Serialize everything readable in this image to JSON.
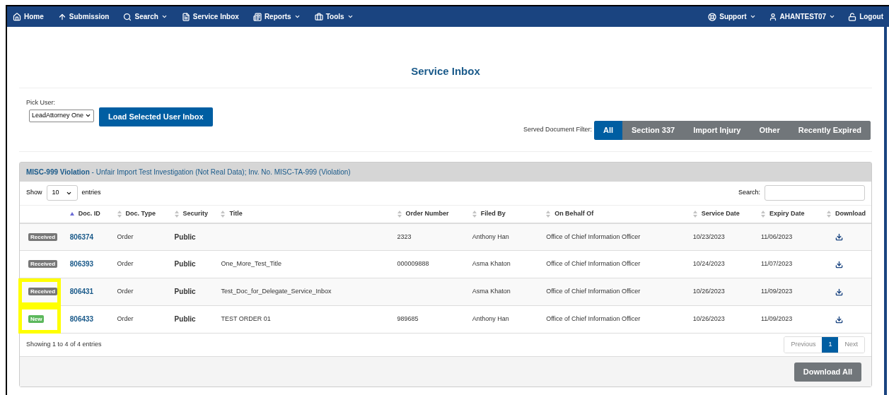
{
  "nav": {
    "left": [
      {
        "label": "Home",
        "caret": false
      },
      {
        "label": "Submission",
        "caret": false
      },
      {
        "label": "Search",
        "caret": true
      },
      {
        "label": "Service Inbox",
        "caret": false
      },
      {
        "label": "Reports",
        "caret": true
      },
      {
        "label": "Tools",
        "caret": true
      }
    ],
    "right": [
      {
        "label": "Support",
        "caret": true
      },
      {
        "label": "AHANTEST07",
        "caret": true
      },
      {
        "label": "Logout",
        "caret": false
      }
    ]
  },
  "page_title": "Service Inbox",
  "pick_user": {
    "label": "Pick User:",
    "value": "LeadAttorney One",
    "button": "Load Selected User Inbox"
  },
  "filter": {
    "label": "Served Document Filter:",
    "options": [
      {
        "label": "All",
        "selected": true
      },
      {
        "label": "Section 337",
        "selected": false
      },
      {
        "label": "Import Injury",
        "selected": false
      },
      {
        "label": "Other",
        "selected": false
      },
      {
        "label": "Recently Expired",
        "selected": false
      }
    ]
  },
  "panel": {
    "case": "MISC-999 Violation",
    "description": " - Unfair Import Test Investigation (Not Real Data); Inv. No. MISC-TA-999 (Violation)",
    "show_label": "Show",
    "page_size": "10",
    "entries_label": "entries",
    "search_label": "Search:",
    "columns": [
      {
        "label": "Doc. ID",
        "sorted": true
      },
      {
        "label": "Doc. Type",
        "sorted": false
      },
      {
        "label": "Security",
        "sorted": false
      },
      {
        "label": "Title",
        "sorted": false
      },
      {
        "label": "Order Number",
        "sorted": false
      },
      {
        "label": "Filed By",
        "sorted": false
      },
      {
        "label": "On Behalf Of",
        "sorted": false
      },
      {
        "label": "Service Date",
        "sorted": false
      },
      {
        "label": "Expiry Date",
        "sorted": false
      },
      {
        "label": "Download",
        "sorted": false
      }
    ],
    "rows": [
      {
        "status": "Received",
        "kind": "received",
        "highlighted": false,
        "doc_id": "806374",
        "doc_type": "Order",
        "security": "Public",
        "title": "",
        "order_number": "2323",
        "filed_by": "Anthony Han",
        "on_behalf_of": "Office of Chief Information Officer",
        "service_date": "10/23/2023",
        "expiry_date": "11/06/2023"
      },
      {
        "status": "Received",
        "kind": "received",
        "highlighted": false,
        "doc_id": "806393",
        "doc_type": "Order",
        "security": "Public",
        "title": "One_More_Test_Title",
        "order_number": "000009888",
        "filed_by": "Asma Khaton",
        "on_behalf_of": "Office of Chief Information Officer",
        "service_date": "10/24/2023",
        "expiry_date": "11/07/2023"
      },
      {
        "status": "Received",
        "kind": "received",
        "highlighted": true,
        "doc_id": "806431",
        "doc_type": "Order",
        "security": "Public",
        "title": "Test_Doc_for_Delegate_Service_Inbox",
        "order_number": "",
        "filed_by": "Asma Khaton",
        "on_behalf_of": "Office of Chief Information Officer",
        "service_date": "10/26/2023",
        "expiry_date": "11/09/2023"
      },
      {
        "status": "New",
        "kind": "new",
        "highlighted": true,
        "doc_id": "806433",
        "doc_type": "Order",
        "security": "Public",
        "title": "TEST ORDER 01",
        "order_number": "989685",
        "filed_by": "Anthony Han",
        "on_behalf_of": "Office of Chief Information Officer",
        "service_date": "10/26/2023",
        "expiry_date": "11/09/2023"
      }
    ],
    "info": "Showing 1 to 4 of 4 entries",
    "pagination": [
      {
        "label": "Previous",
        "selected": false
      },
      {
        "label": "1",
        "selected": true
      },
      {
        "label": "Next",
        "selected": false
      }
    ],
    "download_all": "Download All"
  }
}
